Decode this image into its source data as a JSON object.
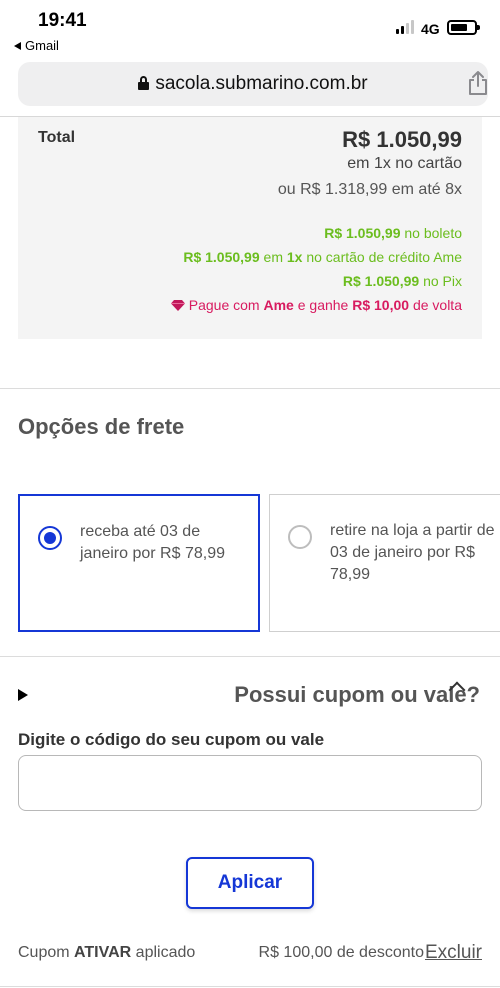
{
  "status_bar": {
    "time": "19:41",
    "back_app": "Gmail",
    "network": "4G"
  },
  "url_bar": {
    "url": "sacola.submarino.com.br"
  },
  "total": {
    "label": "Total",
    "price": "R$ 1.050,99",
    "installment_1x": "em 1x no cartão",
    "installment_8x": "ou R$ 1.318,99 em até 8x",
    "boleto": {
      "value": "R$ 1.050,99",
      "text": "no boleto"
    },
    "ame_card": {
      "value": "R$ 1.050,99",
      "mid": "em",
      "times": "1x",
      "text": "no cartão de crédito Ame"
    },
    "pix": {
      "value": "R$ 1.050,99",
      "text": "no Pix"
    },
    "cashback": {
      "prefix": "Pague com",
      "brand": "Ame",
      "mid": "e ganhe",
      "value": "R$ 10,00",
      "suffix": "de volta"
    }
  },
  "shipping": {
    "title": "Opções de frete",
    "options": [
      {
        "text": "receba até 03 de janeiro por R$ 78,99",
        "selected": true
      },
      {
        "text": "retire na loja a partir de 03 de janeiro por R$ 78,99",
        "selected": false
      }
    ]
  },
  "coupon": {
    "title": "Possui cupom ou vale?",
    "field_label": "Digite o código do seu cupom ou vale",
    "input_value": "",
    "apply_label": "Aplicar",
    "applied_prefix": "Cupom",
    "applied_code": "ATIVAR",
    "applied_suffix": "aplicado",
    "discount_text": "R$ 100,00 de desconto",
    "remove_label": "Excluir"
  },
  "colors": {
    "accent_blue": "#1537d6",
    "green": "#6bbd1e",
    "pink": "#d81b60"
  }
}
